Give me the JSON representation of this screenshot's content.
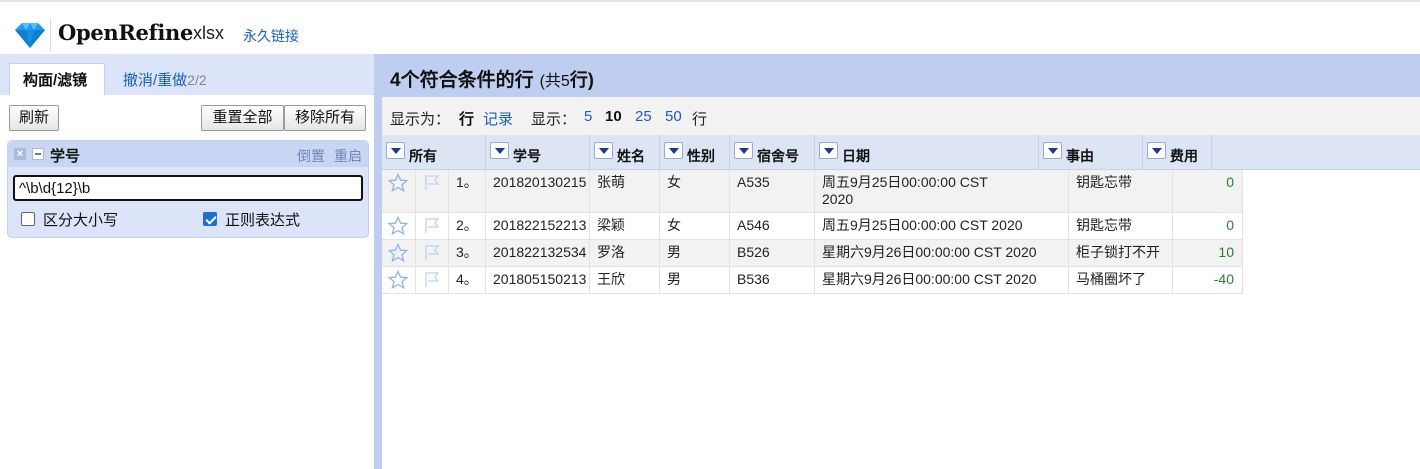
{
  "app": {
    "name": "OpenRefine",
    "project": "xlsx",
    "permalink": "永久链接",
    "logo_icon": "diamond-icon"
  },
  "left_panel": {
    "tabs": {
      "facet_filter": "构面/滤镜",
      "undo_redo": "撤消/重做",
      "undo_count": "2/2"
    },
    "buttons": {
      "refresh": "刷新",
      "reset_all": "重置全部",
      "remove_all": "移除所有"
    },
    "facet": {
      "title": "学号",
      "invert": "倒置",
      "reset": "重启",
      "pattern": "^\\b\\d{12}\\b",
      "case_sensitive_label": "区分大小写",
      "case_sensitive": false,
      "regex_label": "正则表达式",
      "regex": true
    }
  },
  "right_panel": {
    "summary": {
      "main": "4个符合条件的行",
      "total_prefix": "(共",
      "total_count": "5",
      "total_suffix": "行)"
    },
    "view": {
      "show_as": "显示为：",
      "rows": "行",
      "records": "记录",
      "show": "显示：",
      "sizes": [
        "5",
        "10",
        "25",
        "50"
      ],
      "selected_size": "10",
      "unit": "行"
    },
    "columns": [
      "所有",
      "学号",
      "姓名",
      "性别",
      "宿舍号",
      "日期",
      "事由",
      "费用"
    ],
    "rows": [
      {
        "index": "1。",
        "id": "201820130215",
        "name": "张萌",
        "gender": "女",
        "dorm": "A535",
        "date": "周五9月25日00:00:00 CST 2020",
        "reason": "钥匙忘带",
        "fee": "0"
      },
      {
        "index": "2。",
        "id": "201822152213",
        "name": "梁颖",
        "gender": "女",
        "dorm": "A546",
        "date": "周五9月25日00:00:00 CST 2020",
        "reason": "钥匙忘带",
        "fee": "0"
      },
      {
        "index": "3。",
        "id": "201822132534",
        "name": "罗洛",
        "gender": "男",
        "dorm": "B526",
        "date": "星期六9月26日00:00:00 CST 2020",
        "reason": "柜子锁打不开",
        "fee": "10"
      },
      {
        "index": "4。",
        "id": "201805150213",
        "name": "王欣",
        "gender": "男",
        "dorm": "B536",
        "date": "星期六9月26日00:00:00 CST 2020",
        "reason": "马桶圈坏了",
        "fee": "-40"
      }
    ],
    "row_icons": {
      "star": "star-icon",
      "flag": "flag-icon"
    }
  },
  "colors": {
    "accent_link": "#1a5fb4",
    "header_band": "#bfcdf0",
    "numeric_value": "#2e7d32"
  }
}
